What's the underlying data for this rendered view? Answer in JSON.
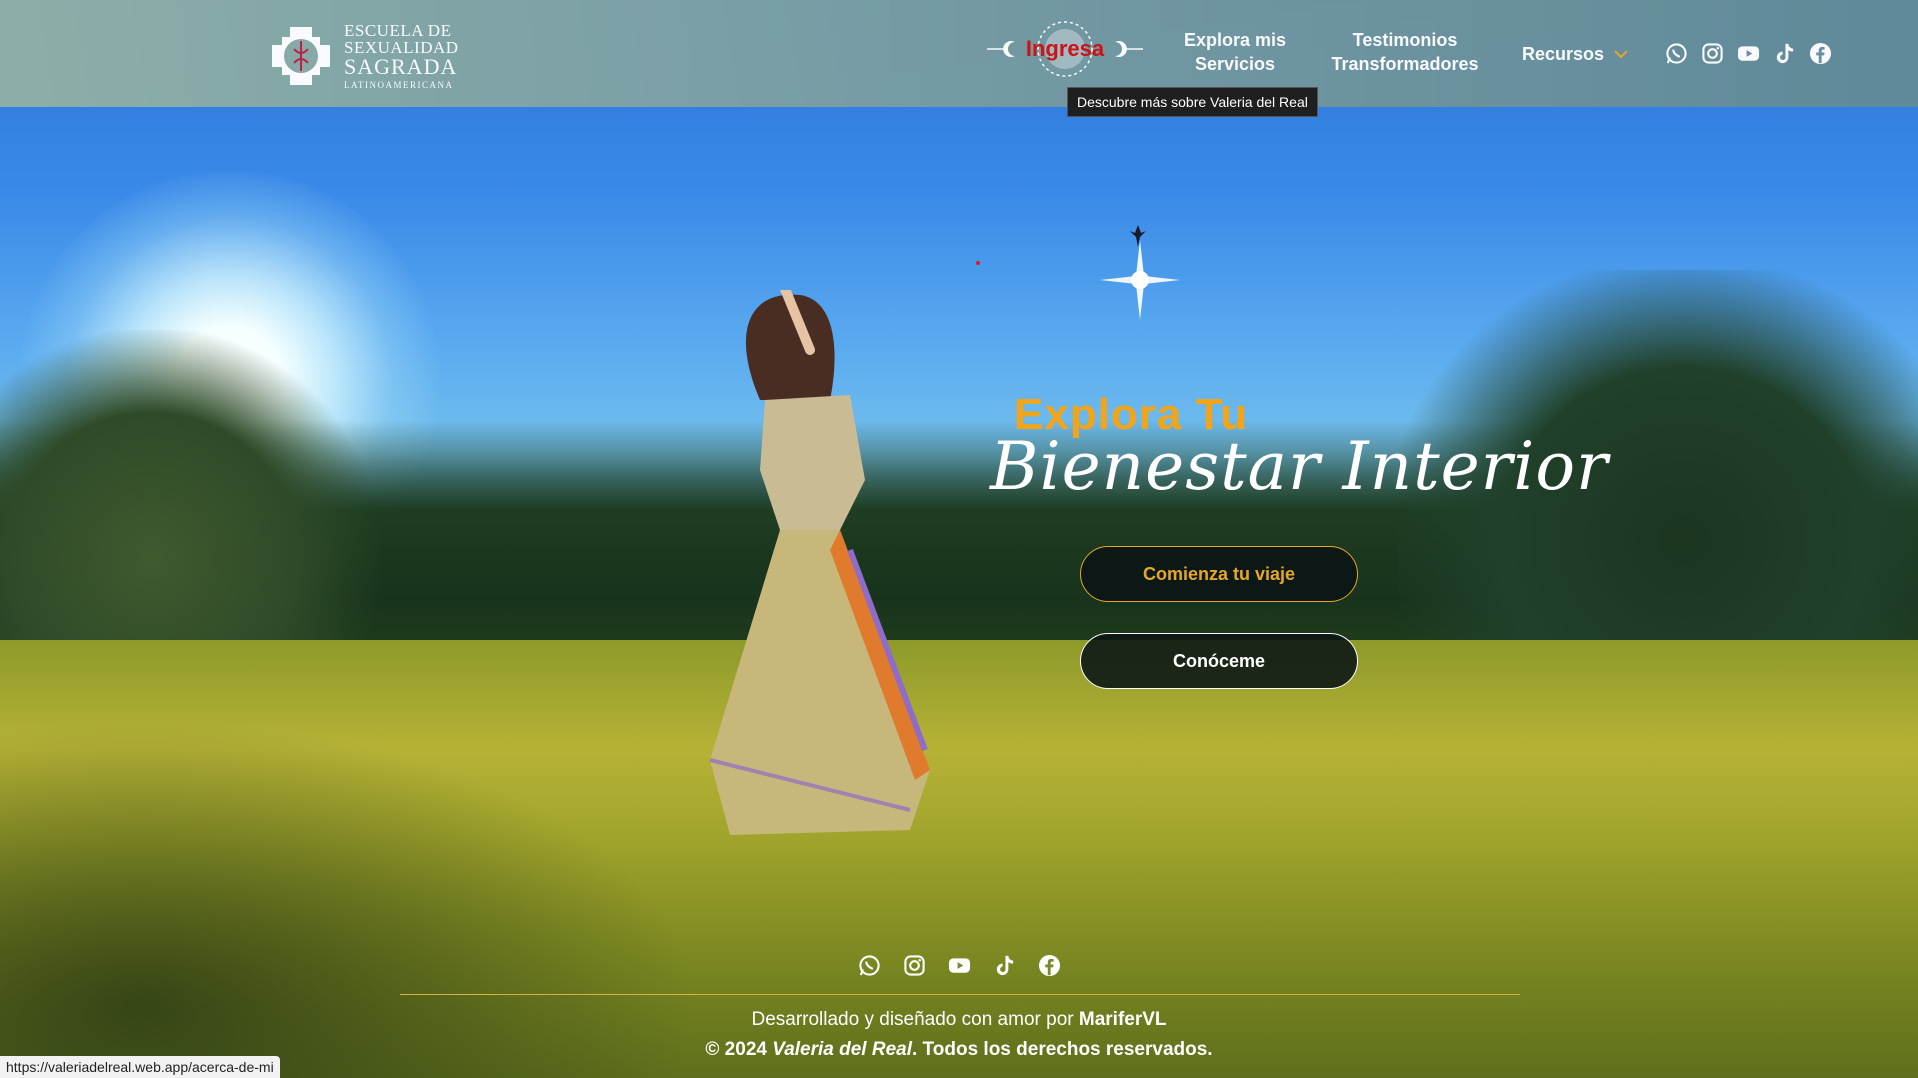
{
  "brand": {
    "line1": "ESCUELA DE",
    "line2": "SEXUALIDAD",
    "line3": "SAGRADA",
    "line4": "LATINOAMERICANA"
  },
  "nav": {
    "login": "Ingresa",
    "services_line1": "Explora mis",
    "services_line2": "Servicios",
    "testimonials_line1": "Testimonios",
    "testimonials_line2": "Transformadores",
    "resources": "Recursos",
    "tooltip": "Descubre más sobre Valeria del Real"
  },
  "social_icons": [
    "whatsapp-icon",
    "instagram-icon",
    "youtube-icon",
    "tiktok-icon",
    "facebook-icon"
  ],
  "hero": {
    "title_line1": "Explora Tu",
    "title_line2": "Bienestar Interior",
    "cta_primary": "Comienza tu viaje",
    "cta_secondary": "Conóceme"
  },
  "footer": {
    "credit_prefix": "Desarrollado y diseñado con amor por ",
    "credit_name": "MariferVL",
    "copyright_prefix": "© 2024 ",
    "copyright_name": "Valeria del Real",
    "copyright_suffix": ". Todos los derechos reservados."
  },
  "status_bar_url": "https://valeriadelreal.web.app/acerca-de-mi",
  "colors": {
    "accent_gold": "#f3a51a",
    "login_red": "#d40f0f"
  }
}
